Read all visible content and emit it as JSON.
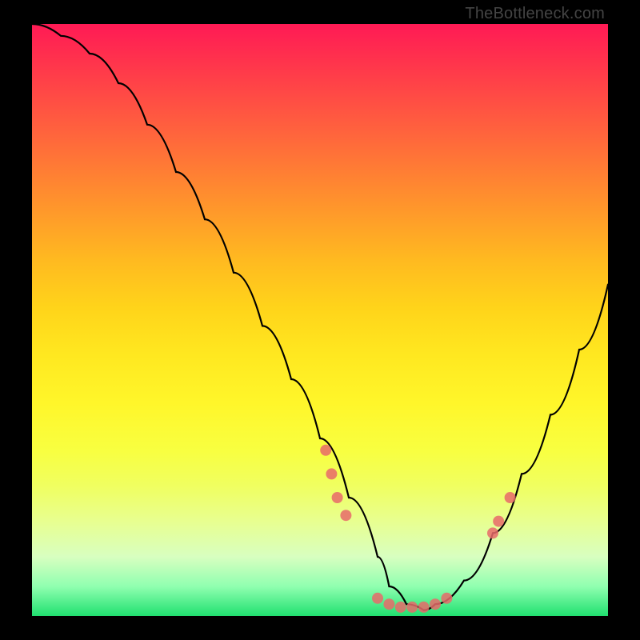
{
  "watermark": "TheBottleneck.com",
  "chart_data": {
    "type": "line",
    "title": "",
    "xlabel": "",
    "ylabel": "",
    "xlim": [
      0,
      100
    ],
    "ylim": [
      0,
      100
    ],
    "series": [
      {
        "name": "bottleneck-curve",
        "x": [
          0,
          5,
          10,
          15,
          20,
          25,
          30,
          35,
          40,
          45,
          50,
          55,
          60,
          62,
          65,
          68,
          70,
          75,
          80,
          85,
          90,
          95,
          100
        ],
        "y": [
          100,
          98,
          95,
          90,
          83,
          75,
          67,
          58,
          49,
          40,
          30,
          20,
          10,
          5,
          2,
          1,
          2,
          6,
          14,
          24,
          34,
          45,
          56
        ]
      }
    ],
    "points": {
      "name": "highlighted-dots",
      "color": "#e86a6a",
      "coords": [
        {
          "x": 51,
          "y": 28
        },
        {
          "x": 52,
          "y": 24
        },
        {
          "x": 53,
          "y": 20
        },
        {
          "x": 54.5,
          "y": 17
        },
        {
          "x": 60,
          "y": 3
        },
        {
          "x": 62,
          "y": 2
        },
        {
          "x": 64,
          "y": 1.5
        },
        {
          "x": 66,
          "y": 1.5
        },
        {
          "x": 68,
          "y": 1.5
        },
        {
          "x": 70,
          "y": 2
        },
        {
          "x": 72,
          "y": 3
        },
        {
          "x": 80,
          "y": 14
        },
        {
          "x": 81,
          "y": 16
        },
        {
          "x": 83,
          "y": 20
        }
      ]
    }
  }
}
